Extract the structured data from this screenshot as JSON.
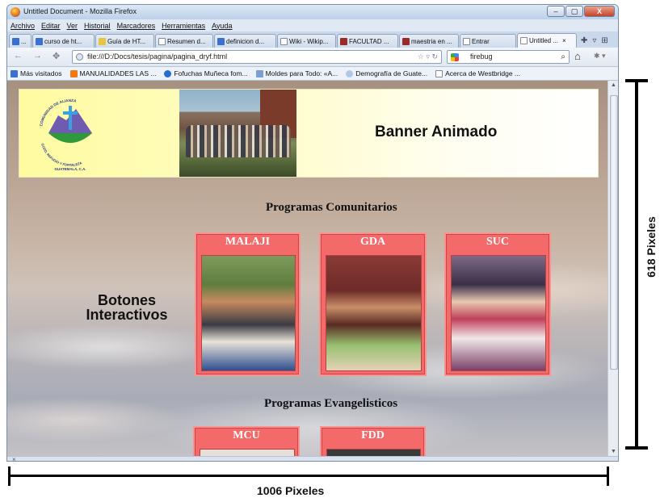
{
  "window": {
    "title": "Untitled Document - Mozilla Firefox",
    "controls": [
      "–",
      "▢",
      "X"
    ]
  },
  "menu": [
    "Archivo",
    "Editar",
    "Ver",
    "Historial",
    "Marcadores",
    "Herramientas",
    "Ayuda"
  ],
  "tabs": [
    {
      "label": "...",
      "color": "#3b6fd0"
    },
    {
      "label": "curso de ht...",
      "color": "#3b6fd0"
    },
    {
      "label": "Guía de HT...",
      "color": "#e6c640"
    },
    {
      "label": "Resumen d...",
      "color": "#ffffff"
    },
    {
      "label": "definicion d...",
      "color": "#3b6fd0"
    },
    {
      "label": "Wiki - Wikip...",
      "color": "#ffffff"
    },
    {
      "label": "FACULTAD ...",
      "color": "#9b2b2b"
    },
    {
      "label": "maestria en ...",
      "color": "#9b2b2b"
    },
    {
      "label": "Entrar",
      "color": "#ffffff"
    },
    {
      "label": "Untitled ...",
      "color": "#ffffff",
      "active": true
    }
  ],
  "tab_close": "×",
  "nav": {
    "url": "file:///D:/Docs/tesis/pagina/pagina_dryf.html",
    "search_value": "firebug"
  },
  "bookmarks": [
    {
      "label": "Más visitados",
      "color": "#3b6fd0"
    },
    {
      "label": "MANUALIDADES LAS ...",
      "color": "#f07a1a"
    },
    {
      "label": "Fofuchas Muñeca fom...",
      "color": "#2a6ad0"
    },
    {
      "label": "Moldes para Todo: «A...",
      "color": "#7aa0d0"
    },
    {
      "label": "Demografía de Guate...",
      "color": "#b0c8e8"
    },
    {
      "label": "Acerca de Westbridge ...",
      "color": "#ffffff"
    }
  ],
  "statusbar": {
    "close_glyph": "×"
  },
  "page": {
    "banner_title": "Banner Animado",
    "logo": {
      "top_text": "COMUNIDAD DE ALIANZA",
      "bottom_text": "GOZO, REFUGIO Y FORTALEZA",
      "place": "GUATEMALA, C.A."
    },
    "section_community": "Programas Comunitarios",
    "section_evangelistic": "Programas Evangelisticos",
    "side_label": [
      "Botones",
      "Interactivos"
    ],
    "community_cards": [
      {
        "label": "MALAJI"
      },
      {
        "label": "GDA"
      },
      {
        "label": "SUC"
      }
    ],
    "evangelistic_cards": [
      {
        "label": "MCU"
      },
      {
        "label": "FDD"
      }
    ]
  },
  "annotations": {
    "width_label": "1006 Pixeles",
    "height_label": "618 Pixeles"
  },
  "colors": {
    "card": "#f46a6a",
    "card_border": "#ff9090",
    "banner_yellow": "#fffba0"
  }
}
